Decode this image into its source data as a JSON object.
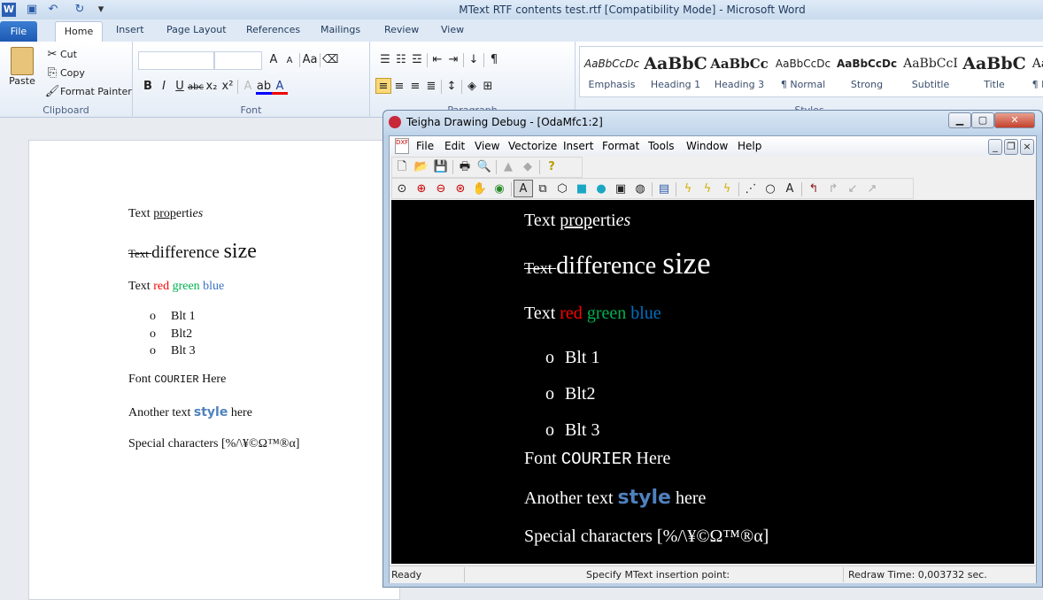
{
  "word": {
    "title": "MText RTF contents test.rtf [Compatibility Mode]  -  Microsoft Word",
    "tabs": [
      "File",
      "Home",
      "Insert",
      "Page Layout",
      "References",
      "Mailings",
      "Review",
      "View"
    ],
    "clipboard": {
      "paste": "Paste",
      "cut": "Cut",
      "copy": "Copy",
      "format_painter": "Format Painter",
      "label": "Clipboard"
    },
    "font": {
      "label": "Font",
      "font_name": "",
      "font_size": ""
    },
    "paragraph": {
      "label": "Paragraph"
    },
    "styles": {
      "label": "Styles",
      "items": [
        {
          "preview": "AaBbCcDc",
          "label": "Emphasis"
        },
        {
          "preview": "AaBbC",
          "label": "Heading 1"
        },
        {
          "preview": "AaBbCc",
          "label": "Heading 3"
        },
        {
          "preview": "AaBbCcDc",
          "label": "¶ Normal"
        },
        {
          "preview": "AaBbCcDc",
          "label": "Strong"
        },
        {
          "preview": "AaBbCcI",
          "label": "Subtitle"
        },
        {
          "preview": "AaBbC",
          "label": "Title"
        },
        {
          "preview": "Aa",
          "label": "¶ N"
        }
      ]
    },
    "document": {
      "line1": {
        "a": "Text ",
        "b": "prop",
        "c": "erti",
        "d": "es"
      },
      "line2": {
        "strike": "Text ",
        "mid": "difference ",
        "big": "size"
      },
      "line3": {
        "a": "Text ",
        "red": "red",
        "green": "green",
        "blue": "blue"
      },
      "bullets": [
        "Blt 1",
        "Blt2",
        "Blt 3"
      ],
      "bullet_symbol": "o",
      "line4": {
        "a": "Font ",
        "courier": "COURIER",
        "b": " Here"
      },
      "line5": {
        "a": "Another text ",
        "style": "style",
        "b": " here"
      },
      "line6": "Special characters [%/\\¥©Ω™®α]"
    }
  },
  "teigha": {
    "title": "Teigha Drawing Debug - [OdaMfc1:2]",
    "menu": [
      "File",
      "Edit",
      "View",
      "Vectorize",
      "Insert",
      "Format",
      "Tools",
      "Window",
      "Help"
    ],
    "status": {
      "ready": "Ready",
      "prompt": "Specify MText insertion point:",
      "redraw": "Redraw Time: 0,003732 sec."
    }
  },
  "colors": {
    "red": "#ff0000",
    "green": "#00b050",
    "blue": "#0070c0",
    "style_blue": "#4f81bd"
  }
}
